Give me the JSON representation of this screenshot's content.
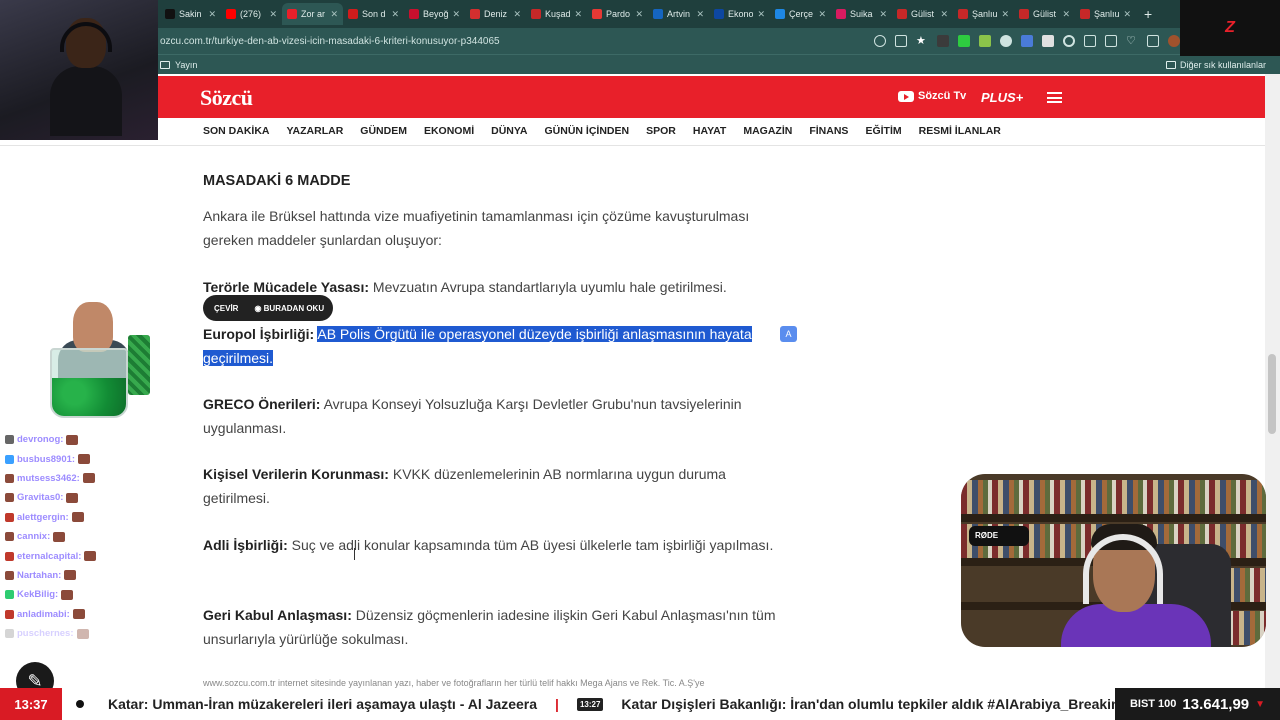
{
  "browser": {
    "tabs": [
      {
        "label": "Sakin",
        "color": "#111111"
      },
      {
        "label": "(276)",
        "color": "#ff0000"
      },
      {
        "label": "Zor ar",
        "color": "#e8202a",
        "active": true
      },
      {
        "label": "Son d",
        "color": "#d01c1c"
      },
      {
        "label": "Beyoğ",
        "color": "#c8102e"
      },
      {
        "label": "Deniz",
        "color": "#d32f2f"
      },
      {
        "label": "Kuşad",
        "color": "#c62828"
      },
      {
        "label": "Pardo",
        "color": "#e53935"
      },
      {
        "label": "Artvin",
        "color": "#1565c0"
      },
      {
        "label": "Ekono",
        "color": "#0d47a1"
      },
      {
        "label": "Çerçe",
        "color": "#1e88e5"
      },
      {
        "label": "Suika",
        "color": "#d81b60"
      },
      {
        "label": "Gülist",
        "color": "#c62828"
      },
      {
        "label": "Şanlıu",
        "color": "#c62828"
      },
      {
        "label": "Gülist",
        "color": "#c62828"
      },
      {
        "label": "Şanlıu",
        "color": "#c62828"
      }
    ],
    "new_tab": "+",
    "url": "ozcu.com.tr/turkiye-den-ab-vizesi-icin-masadaki-6-kriteri-konusuyor-p344065",
    "bookmark": "Yayın",
    "other_bookmarks": "Diğer sık kullanılanlar"
  },
  "site": {
    "logo": "Sözcü",
    "youtube": "Sözcü Tv",
    "plus": "PLUS+",
    "nav": [
      "SON DAKİKA",
      "YAZARLAR",
      "GÜNDEM",
      "EKONOMİ",
      "DÜNYA",
      "GÜNÜN İÇİNDEN",
      "SPOR",
      "HAYAT",
      "MAGAZİN",
      "FİNANS",
      "EĞİTİM",
      "RESMİ İLANLAR"
    ]
  },
  "article": {
    "subhead": "MASADAKİ 6 MADDE",
    "intro": "Ankara ile Brüksel hattında vize muafiyetinin tamamlanması için çözüme kavuşturulması gereken maddeler şunlardan oluşuyor:",
    "items": [
      {
        "title": "Terörle Mücadele Yasası:",
        "text": " Mevzuatın Avrupa standartlarıyla uyumlu hale getirilmesi."
      },
      {
        "title": "Europol İşbirliği:",
        "text": "AB Polis Örgütü ile operasyonel düzeyde işbirliği anlaşmasının hayata geçirilmesi."
      },
      {
        "title": "GRECO Önerileri:",
        "text": " Avrupa Konseyi Yolsuzluğa Karşı Devletler Grubu'nun tavsiyelerinin uygulanması."
      },
      {
        "title": "Kişisel Verilerin Korunması:",
        "text": " KVKK düzenlemelerinin AB normlarına uygun duruma getirilmesi."
      },
      {
        "title": "Adli İşbirliği:",
        "text": " Suç ve adli konular kapsamında tüm AB üyesi ülkelerle tam işbirliği yapılması."
      },
      {
        "title": "Geri Kabul Anlaşması:",
        "text": " Düzensiz göçmenlerin iadesine ilişkin Geri Kabul Anlaşması'nın tüm unsurlarıyla yürürlüğe sokulması."
      }
    ],
    "footnote": "www.sozcu.com.tr internet sitesinde yayınlanan yazı, haber ve fotoğrafların her türlü telif hakkı Mega Ajans ve Rek. Tic. A.Ş'ye"
  },
  "translate_popup": {
    "translate": "ÇEVİR",
    "read": "BURADAN OKU"
  },
  "stream": {
    "chat": [
      {
        "name": "devronog:",
        "badge": "#666666"
      },
      {
        "name": "busbus8901:",
        "badge": "#3aa0ff"
      },
      {
        "name": "mutsess3462:",
        "badge": "#8b4a3a"
      },
      {
        "name": "Gravitas0:",
        "badge": "#8b4a3a"
      },
      {
        "name": "alettgergin:",
        "badge": "#c0392b"
      },
      {
        "name": "cannix:",
        "badge": "#8b4a3a"
      },
      {
        "name": "eternalcapital:",
        "badge": "#c0392b"
      },
      {
        "name": "Nartahan:",
        "badge": "#8b4a3a"
      },
      {
        "name": "KekBilig:",
        "badge": "#2ecc71"
      },
      {
        "name": "anladimabi:",
        "badge": "#c0392b"
      },
      {
        "name": "puschernes:",
        "badge": "#999999"
      }
    ],
    "mic_label": "RØDE",
    "z_logo": "Z"
  },
  "ticker": {
    "time": "13:37",
    "headline1": "Katar: Umman-İran müzakereleri ileri aşamaya ulaştı - Al Jazeera",
    "separator": "|",
    "mini_time": "13:27",
    "headline2": "Katar Dışişleri Bakanlığı: İran'dan olumlu tepkiler aldık #AlArabiya_Breaking",
    "index_label": "BIST 100",
    "index_value": "13.641,99",
    "index_arrow": "▼"
  }
}
